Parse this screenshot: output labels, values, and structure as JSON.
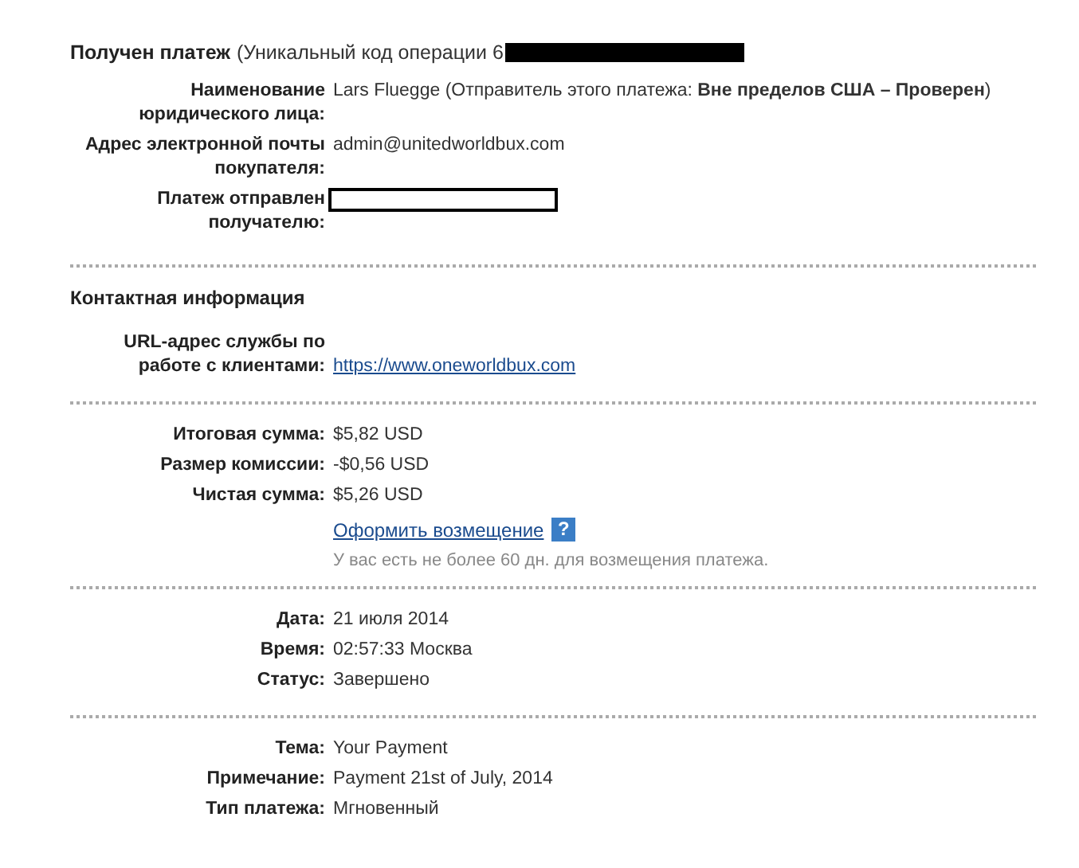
{
  "header": {
    "title": "Получен платеж",
    "detail": "(Уникальный код операции 6"
  },
  "sections": [
    {
      "rows": [
        {
          "kind": "rich",
          "label": "Наименование юридического лица:",
          "value": "Lars Fluegge (Отправитель этого платежа: **Вне пределов США – Проверен**)"
        },
        {
          "kind": "text",
          "label": "Адрес электронной почты покупателя:",
          "value": "admin@unitedworldbux.com"
        },
        {
          "kind": "redacted",
          "label": "Платеж отправлен получателю:"
        }
      ]
    },
    {
      "title": "Контактная информация",
      "rows": [
        {
          "kind": "link",
          "label": "URL-адрес службы по работе с клиентами:",
          "value": "https://www.oneworldbux.com"
        }
      ]
    },
    {
      "rows": [
        {
          "kind": "text",
          "label": "Итоговая сумма:",
          "value": "$5,82 USD"
        },
        {
          "kind": "text",
          "label": "Размер комиссии:",
          "value": "-$0,56 USD"
        },
        {
          "kind": "text",
          "label": "Чистая сумма:",
          "value": "$5,26 USD"
        }
      ],
      "refund": {
        "link": "Оформить возмещение",
        "help": "?",
        "note": "У вас есть не более 60 дн. для возмещения платежа."
      }
    },
    {
      "rows": [
        {
          "kind": "text",
          "label": "Дата:",
          "value": "21 июля 2014"
        },
        {
          "kind": "text",
          "label": "Время:",
          "value": "02:57:33 Москва"
        },
        {
          "kind": "text",
          "label": "Статус:",
          "value": "Завершено"
        }
      ]
    },
    {
      "rows": [
        {
          "kind": "text",
          "label": "Тема:",
          "value": "Your Payment"
        },
        {
          "kind": "text",
          "label": "Примечание:",
          "value": "Payment 21st of July, 2014"
        },
        {
          "kind": "text",
          "label": "Тип платежа:",
          "value": "Мгновенный"
        }
      ]
    }
  ]
}
